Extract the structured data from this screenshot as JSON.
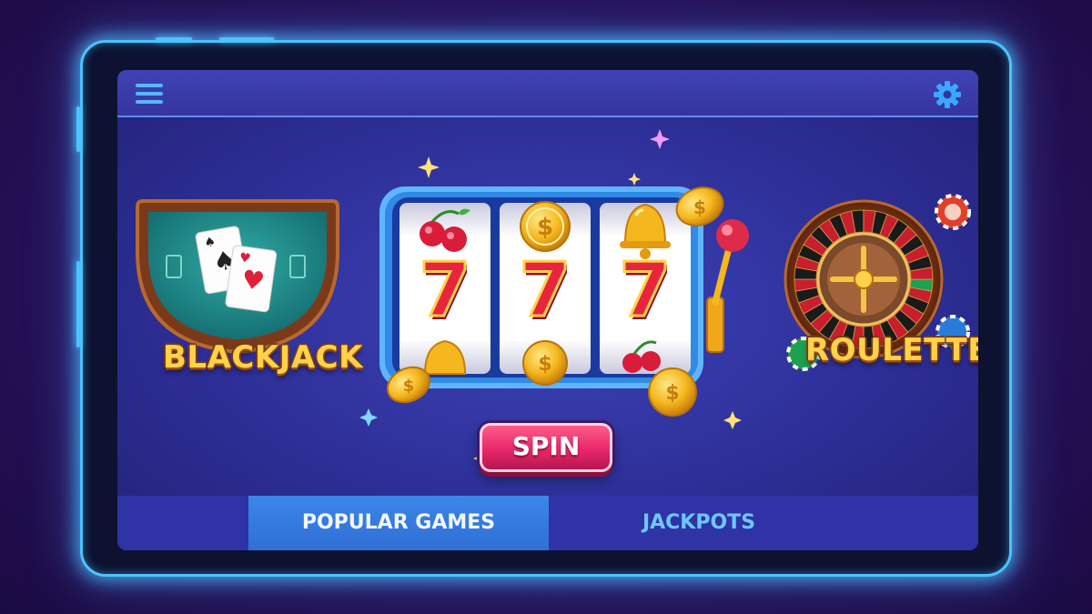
{
  "header": {
    "menu_icon": "hamburger-menu-icon",
    "settings_icon": "gear-icon"
  },
  "games": {
    "blackjack": {
      "label": "BLACKJACK"
    },
    "slot_machine": {
      "reels": [
        [
          "cherry",
          "coin",
          "bell"
        ],
        [
          "seven",
          "seven",
          "seven"
        ],
        [
          "bell",
          "coin",
          "cherry"
        ]
      ]
    },
    "roulette": {
      "label": "ROULETTE"
    }
  },
  "spin_button": {
    "label": "SPIN"
  },
  "tabs": [
    {
      "label": "POPULAR GAMES",
      "active": true
    },
    {
      "label": "JACKPOTS",
      "active": false
    }
  ],
  "colors": {
    "frame_glow": "#4cc3ff",
    "label_gold": "#ffd24a",
    "spin_pink": "#e8286a",
    "tab_active": "#3b87e8"
  }
}
